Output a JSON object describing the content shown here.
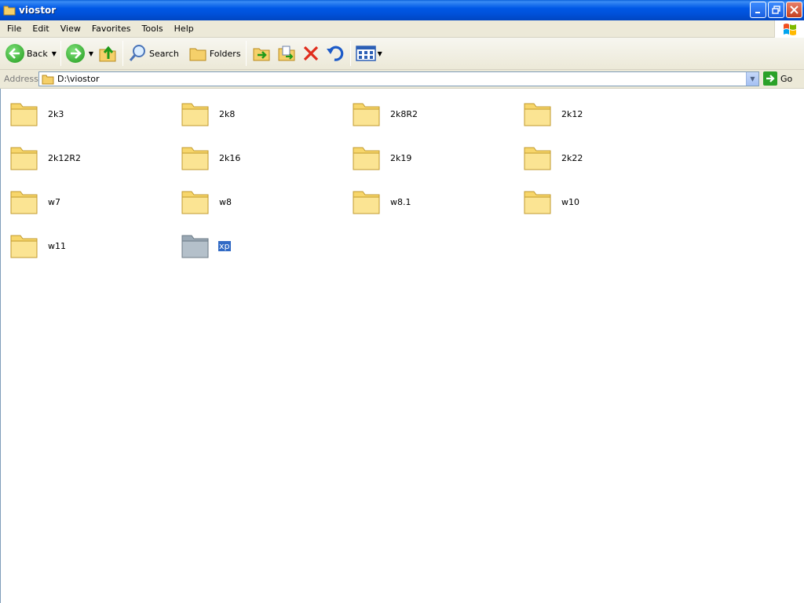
{
  "window": {
    "title": "viostor"
  },
  "menu": [
    "File",
    "Edit",
    "View",
    "Favorites",
    "Tools",
    "Help"
  ],
  "toolbar": {
    "back_label": "Back",
    "search_label": "Search",
    "folders_label": "Folders"
  },
  "address": {
    "label": "Address",
    "value": "D:\\viostor",
    "go_label": "Go"
  },
  "folders": [
    {
      "name": "2k3",
      "selected": false
    },
    {
      "name": "2k8",
      "selected": false
    },
    {
      "name": "2k8R2",
      "selected": false
    },
    {
      "name": "2k12",
      "selected": false
    },
    {
      "name": "2k12R2",
      "selected": false
    },
    {
      "name": "2k16",
      "selected": false
    },
    {
      "name": "2k19",
      "selected": false
    },
    {
      "name": "2k22",
      "selected": false
    },
    {
      "name": "w7",
      "selected": false
    },
    {
      "name": "w8",
      "selected": false
    },
    {
      "name": "w8.1",
      "selected": false
    },
    {
      "name": "w10",
      "selected": false
    },
    {
      "name": "w11",
      "selected": false
    },
    {
      "name": "xp",
      "selected": true
    }
  ],
  "colors": {
    "titlebar": "#0054e3",
    "chrome": "#ece9d8",
    "selection": "#316ac5",
    "folder": "#f7d66b"
  }
}
